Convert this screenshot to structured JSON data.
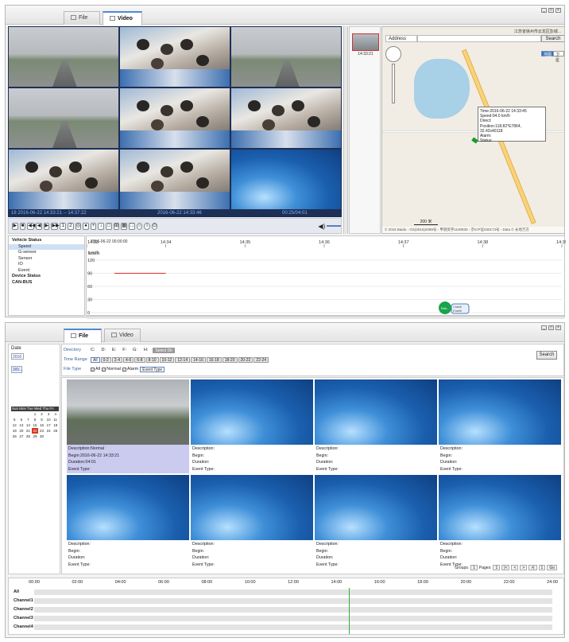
{
  "top": {
    "tabs": [
      {
        "label": "File"
      },
      {
        "label": "Video"
      }
    ],
    "status": {
      "start": "18  2016-06-22 14:33:21 -- 14:37:22",
      "current": "2016-06-22 14:33:46",
      "counter": "00:25/04:01"
    },
    "map": {
      "place": "江苏省徐州市云龙区彭城...",
      "address_label": "Address",
      "search_label": "Search",
      "btn_map": "地图",
      "btn_sat": "卫星",
      "popup": {
        "time": "Time:2016-06-22 14:33:45",
        "speed": "Speed:94.0 km/h",
        "direct": "Direct:",
        "position": "Position:118.82°E7864, 32.42x40118",
        "alarm": "Alarm:",
        "status": "Status:"
      },
      "scale": "200 米",
      "footer": "© 2016 Baidu - GS(2016)2089号 - 甲测资字1100930 - 京ICP证030173号 - Data © 长地万方"
    },
    "thumb_time": "14:33:21",
    "tree": [
      {
        "label": "Vehicle Status",
        "group": true
      },
      {
        "label": "Speed",
        "selected": true
      },
      {
        "label": "G-sensor"
      },
      {
        "label": "Sensor"
      },
      {
        "label": "IO"
      },
      {
        "label": "Event"
      },
      {
        "label": "Device Status",
        "group": true
      },
      {
        "label": "CAN-BUS",
        "group": true
      }
    ],
    "chart_start_label": "2016-06-22 00:00:00",
    "chart_tag": {
      "line1": "Reh-",
      "line2": "1 km/h",
      "line3": "0 km/h"
    }
  },
  "chart_data": {
    "type": "line",
    "title": "",
    "xlabel": "",
    "ylabel": "km/h",
    "x_ticks": [
      "14:33",
      "14:34",
      "14:35",
      "14:36",
      "14:37",
      "14:38",
      "14:39"
    ],
    "y_ticks": [
      0,
      30,
      60,
      90,
      120
    ],
    "ylim": [
      0,
      120
    ],
    "series": [
      {
        "color": "#e02b2b",
        "x": [
          "14:33:21",
          "14:34:00"
        ],
        "y": [
          90,
          90
        ]
      }
    ]
  },
  "bottom": {
    "tabs": [
      {
        "label": "File"
      },
      {
        "label": "Video"
      }
    ],
    "date_label": "Date",
    "date_value": "2016",
    "cal_btn": "3/6/...",
    "cal_header": "Sun Mon Tue Wed Thu Fri Sat",
    "cal_days": [
      "",
      "",
      "",
      "1",
      "2",
      "3",
      "4",
      "5",
      "6",
      "7",
      "8",
      "9",
      "10",
      "11",
      "12",
      "13",
      "14",
      "15",
      "16",
      "17",
      "18",
      "19",
      "20",
      "21",
      "22",
      "23",
      "24",
      "25",
      "26",
      "27",
      "28",
      "29",
      "30",
      "",
      ""
    ],
    "cal_today": "22",
    "directory_label": "Directory",
    "drives": [
      "C:",
      "D:",
      "E:",
      "F:",
      "G:",
      "H:"
    ],
    "select_dir": "Select Dir",
    "time_range_label": "Time Range",
    "ranges": [
      "All",
      "0-2",
      "2-4",
      "4-6",
      "6-8",
      "8-10",
      "10-12",
      "12-14",
      "14-16",
      "16-18",
      "18-20",
      "20-22",
      "22-24"
    ],
    "file_type_label": "File Type",
    "file_types": [
      "All",
      "Normal",
      "Alarm"
    ],
    "event_type_btn": "Event Type",
    "search_btn": "Search",
    "results": [
      {
        "desc": "Description:Normal",
        "begin": "Begin:2016-06-22 14:33:21",
        "dur": "Duration:04:01",
        "event": "Event Type:"
      },
      {
        "desc": "Description:",
        "begin": "Begin:",
        "dur": "Duration:",
        "event": "Event Type:"
      },
      {
        "desc": "Description:",
        "begin": "Begin:",
        "dur": "Duration:",
        "event": "Event Type:"
      },
      {
        "desc": "Description:",
        "begin": "Begin:",
        "dur": "Duration:",
        "event": "Event Type:"
      },
      {
        "desc": "Description:",
        "begin": "Begin:",
        "dur": "Duration:",
        "event": "Event Type:"
      },
      {
        "desc": "Description:",
        "begin": "Begin:",
        "dur": "Duration:",
        "event": "Event Type:"
      },
      {
        "desc": "Description:",
        "begin": "Begin:",
        "dur": "Duration:",
        "event": "Event Type:"
      },
      {
        "desc": "Description:",
        "begin": "Begin:",
        "dur": "Duration:",
        "event": "Event Type:"
      }
    ],
    "pager": {
      "groups_label": "Groups:",
      "groups": "1",
      "pages_label": "Pages:",
      "pages": "1",
      "first": "|<",
      "prev": "<",
      "next": ">",
      "last": ">|",
      "page_input": "1",
      "go": "Go"
    },
    "timeline_hours": [
      "00:00",
      "02:00",
      "04:00",
      "06:00",
      "08:00",
      "10:00",
      "12:00",
      "14:00",
      "16:00",
      "18:00",
      "20:00",
      "22:00",
      "24:00"
    ],
    "timeline_rows": [
      "All",
      "Channel1",
      "Channel2",
      "Channel3",
      "Channel4"
    ]
  }
}
